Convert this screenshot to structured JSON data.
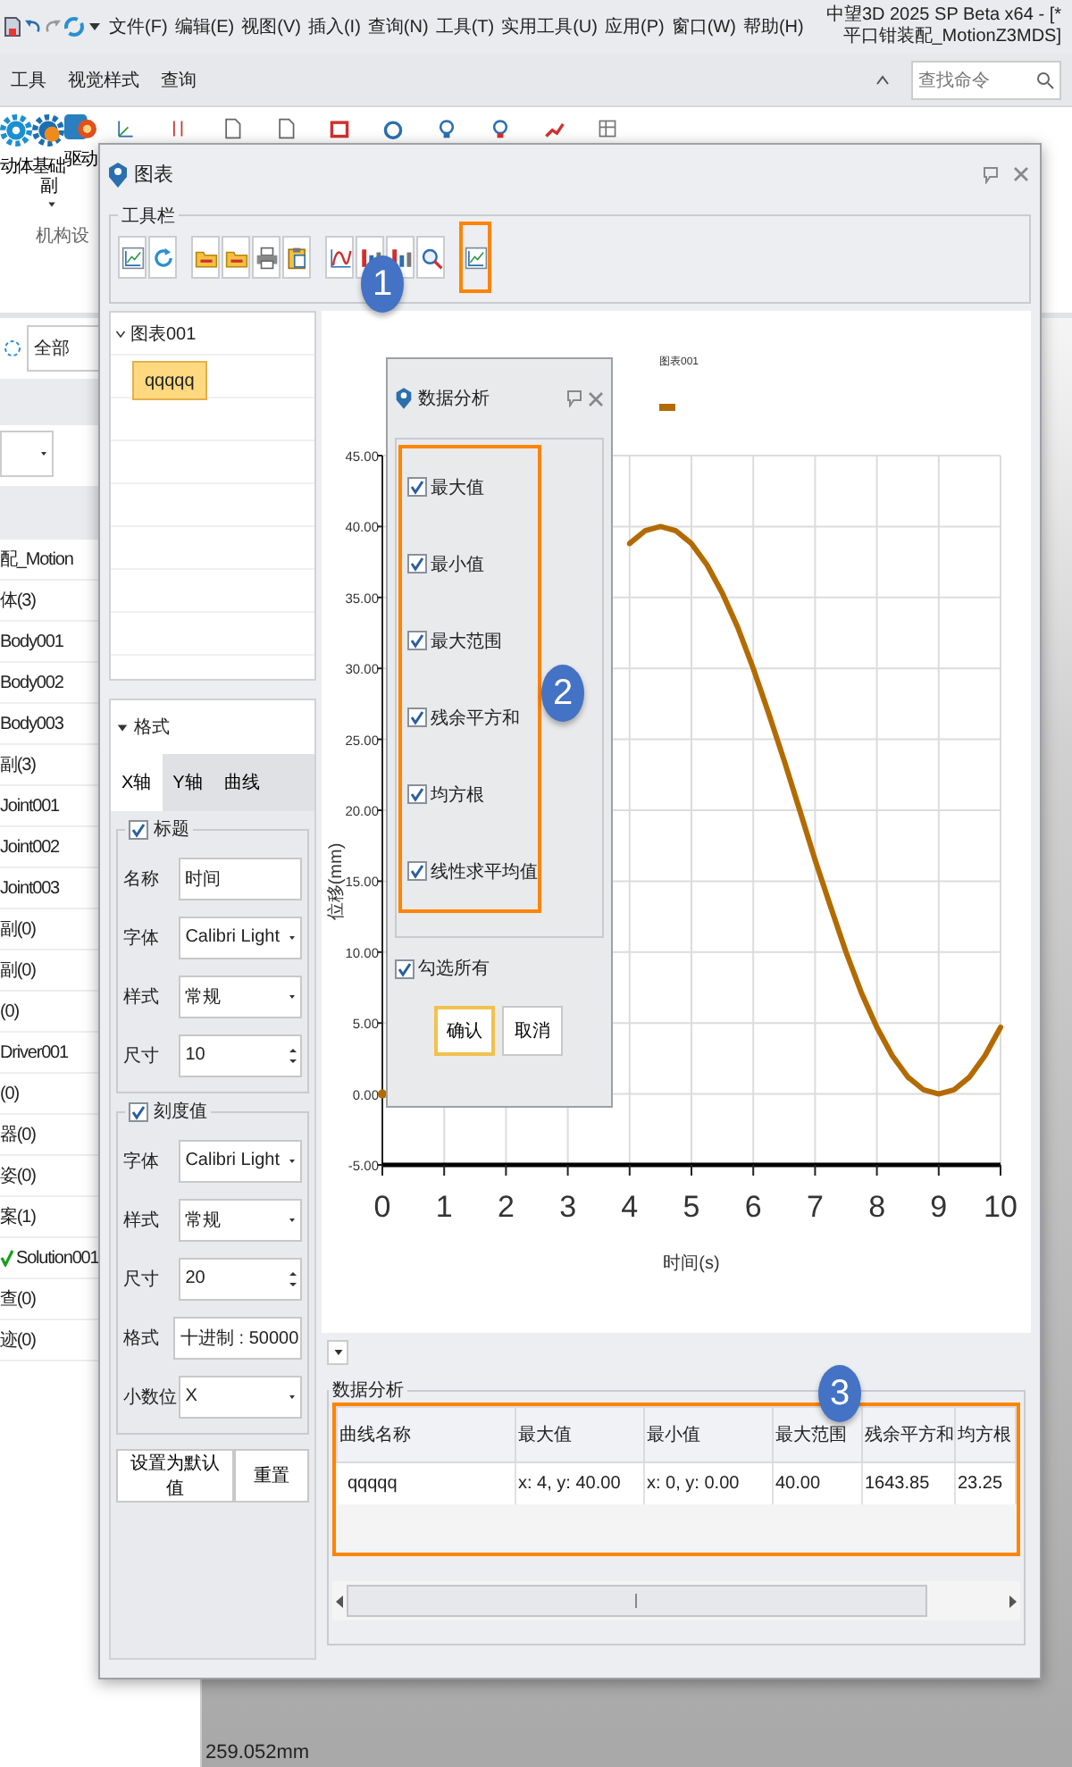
{
  "app": {
    "menu": [
      "文件(F)",
      "编辑(E)",
      "视图(V)",
      "插入(I)",
      "查询(N)",
      "工具(T)",
      "实用工具(U)",
      "应用(P)",
      "窗口(W)",
      "帮助(H)"
    ],
    "title": "中望3D 2025 SP Beta x64 - [* 平口钳装配_MotionZ3MDS]"
  },
  "ribbon_tabs": [
    "工具",
    "视觉样式",
    "查询"
  ],
  "search": {
    "placeholder": "查找命令"
  },
  "ribbon": {
    "buttons": [
      "动体",
      "基础副",
      "驱动"
    ],
    "group_label": "机构设"
  },
  "left_panel": {
    "filter": "全部",
    "items": [
      {
        "label": "配_Motion",
        "checked": false
      },
      {
        "label": "体(3)",
        "checked": false
      },
      {
        "label": "Body001",
        "checked": false
      },
      {
        "label": "Body002",
        "checked": false
      },
      {
        "label": "Body003",
        "checked": false
      },
      {
        "label": "副(3)",
        "checked": false
      },
      {
        "label": "Joint001",
        "checked": false
      },
      {
        "label": "Joint002",
        "checked": false
      },
      {
        "label": "Joint003",
        "checked": false
      },
      {
        "label": "副(0)",
        "checked": false
      },
      {
        "label": "副(0)",
        "checked": false
      },
      {
        "label": "(0)",
        "checked": false
      },
      {
        "label": "Driver001",
        "checked": false
      },
      {
        "label": "(0)",
        "checked": false
      },
      {
        "label": "器(0)",
        "checked": false
      },
      {
        "label": "姿(0)",
        "checked": false
      },
      {
        "label": "案(1)",
        "checked": false
      },
      {
        "label": "Solution001",
        "checked": true
      },
      {
        "label": "查(0)",
        "checked": false
      },
      {
        "label": "迹(0)",
        "checked": false
      }
    ]
  },
  "viewport": {
    "measurement": "259.052mm"
  },
  "chart_window": {
    "title": "图表",
    "toolbar_label": "工具栏",
    "toolbar": [
      {
        "kind": "chart",
        "highlighted": false
      },
      {
        "kind": "refresh",
        "highlighted": false
      },
      {
        "kind": "folder",
        "highlighted": false
      },
      {
        "kind": "folder",
        "highlighted": false
      },
      {
        "kind": "printer",
        "highlighted": false
      },
      {
        "kind": "clipboard",
        "highlighted": false
      },
      {
        "kind": "curve",
        "highlighted": false
      },
      {
        "kind": "bars",
        "highlighted": false
      },
      {
        "kind": "bars",
        "highlighted": false
      },
      {
        "kind": "magnifier",
        "highlighted": false
      },
      {
        "kind": "chart",
        "highlighted": true
      }
    ],
    "tree": {
      "label": "图表001",
      "expanded": true,
      "children": [
        {
          "label": "qqqqq",
          "selected": true
        }
      ]
    },
    "format": {
      "title": "格式",
      "tabs": [
        {
          "label": "X轴",
          "selected": true
        },
        {
          "label": "Y轴",
          "selected": false
        },
        {
          "label": "曲线",
          "selected": false
        }
      ],
      "groups": [
        {
          "label": "标题",
          "checked": true,
          "fields": [
            {
              "label": "名称",
              "value": "时间",
              "kind": "text"
            },
            {
              "label": "字体",
              "value": "Calibri Light",
              "kind": "dropdown"
            },
            {
              "label": "样式",
              "value": "常规",
              "kind": "dropdown"
            },
            {
              "label": "尺寸",
              "value": "10",
              "kind": "spin"
            }
          ]
        },
        {
          "label": "刻度值",
          "checked": true,
          "fields": [
            {
              "label": "字体",
              "value": "Calibri Light",
              "kind": "dropdown"
            },
            {
              "label": "样式",
              "value": "常规",
              "kind": "dropdown"
            },
            {
              "label": "尺寸",
              "value": "20",
              "kind": "spin"
            },
            {
              "label": "格式",
              "value": "十进制 : 50000",
              "kind": "dropdown"
            },
            {
              "label": "小数位",
              "value": "X",
              "kind": "dropdown"
            }
          ]
        }
      ],
      "buttons": [
        "设置为默认值",
        "重置"
      ]
    },
    "chart": {
      "chart_data": {
        "type": "line",
        "xlabel": "时间(s)",
        "ylabel": "位移(mm)",
        "x": [
          0,
          0.25,
          0.5,
          0.75,
          1,
          1.25,
          1.5,
          1.75,
          2,
          2.25,
          2.5,
          2.75,
          3,
          3.25,
          3.5,
          3.75,
          4,
          4.25,
          4.5,
          4.75,
          5,
          5.25,
          5.5,
          5.75,
          6,
          6.25,
          6.5,
          6.75,
          7,
          7.25,
          7.5,
          7.75,
          8,
          8.25,
          8.5,
          8.75,
          9,
          9.25,
          9.5,
          9.75,
          10
        ],
        "series": [
          {
            "name": "图表001",
            "color": "#b36b00",
            "values": [
              0,
              null,
              null,
              null,
              null,
              null,
              null,
              null,
              null,
              null,
              null,
              null,
              null,
              null,
              null,
              null,
              38.8,
              39.7,
              40,
              39.7,
              38.8,
              37.3,
              35.3,
              32.9,
              30,
              26.8,
              23.5,
              20,
              16.5,
              13.2,
              10,
              7.1,
              4.7,
              2.7,
              1.2,
              0.3,
              0,
              0.3,
              1.2,
              2.7,
              4.7
            ]
          }
        ],
        "grid": true,
        "xlim": [
          0,
          10
        ],
        "ylim": [
          -5,
          45
        ],
        "xticks": [
          0,
          1,
          2,
          3,
          4,
          5,
          6,
          7,
          8,
          9,
          10
        ],
        "yticks": [
          {
            "value": 45,
            "label": "45.00"
          },
          {
            "value": 40,
            "label": "40.00"
          },
          {
            "value": 35,
            "label": "35.00"
          },
          {
            "value": 30,
            "label": "30.00"
          },
          {
            "value": 25,
            "label": "25.00"
          },
          {
            "value": 20,
            "label": "20.00"
          },
          {
            "value": 15,
            "label": "15.00"
          },
          {
            "value": 10,
            "label": "10.00"
          },
          {
            "value": 5,
            "label": "5.00"
          },
          {
            "value": 0,
            "label": "0.00"
          },
          {
            "value": -5,
            "label": "-5.00"
          }
        ]
      }
    },
    "analysis": {
      "title": "数据分析",
      "columns": [
        "曲线名称",
        "最大值",
        "最小值",
        "最大范围",
        "残余平方和",
        "均方根"
      ],
      "rows": [
        [
          "qqqqq",
          "x: 4, y: 40.00",
          "x: 0, y: 0.00",
          "40.00",
          "1643.85",
          "23.25"
        ]
      ],
      "highlighted": true
    }
  },
  "analysis_dialog": {
    "title": "数据分析",
    "highlighted": true,
    "options": [
      {
        "label": "最大值",
        "checked": true
      },
      {
        "label": "最小值",
        "checked": true
      },
      {
        "label": "最大范围",
        "checked": true
      },
      {
        "label": "残余平方和",
        "checked": true
      },
      {
        "label": "均方根",
        "checked": true
      },
      {
        "label": "线性求平均值",
        "checked": true
      }
    ],
    "select_all": {
      "label": "勾选所有",
      "checked": true
    },
    "buttons": [
      {
        "label": "确认",
        "focused": true
      },
      {
        "label": "取消",
        "focused": false
      }
    ]
  },
  "callouts": [
    "1",
    "2",
    "3"
  ]
}
